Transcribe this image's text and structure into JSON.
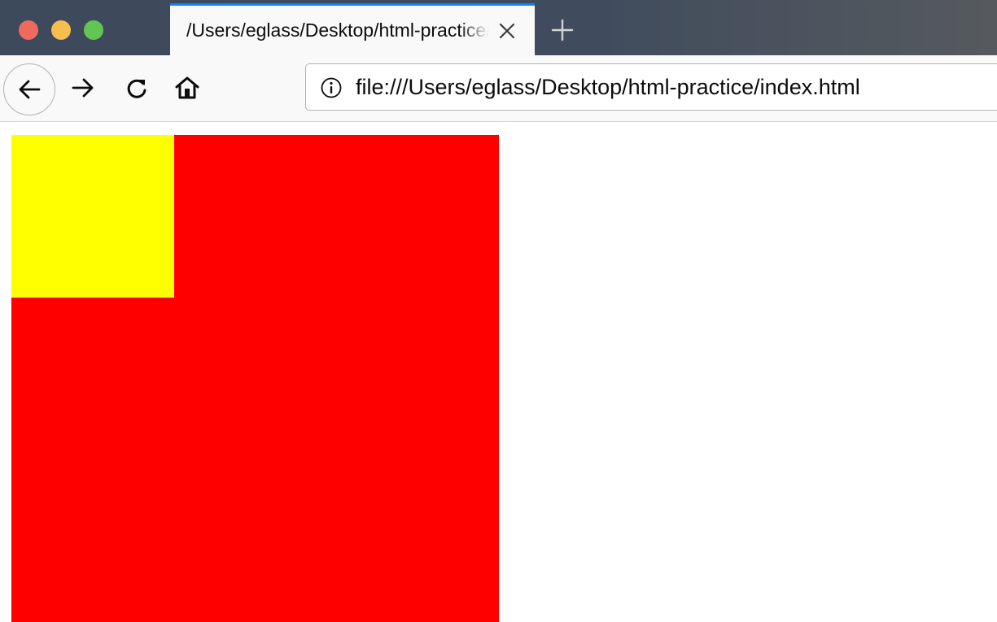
{
  "window": {
    "controls": {
      "close_color": "#ee6a5f",
      "minimize_color": "#f5be4f",
      "maximize_color": "#62c554"
    }
  },
  "tabs": [
    {
      "title": "/Users/eglass/Desktop/html-practice/index.html",
      "active": true,
      "close_icon": "close-icon"
    }
  ],
  "new_tab_icon": "plus-icon",
  "toolbar": {
    "back_icon": "back-arrow-icon",
    "forward_icon": "forward-arrow-icon",
    "reload_icon": "reload-icon",
    "home_icon": "home-icon",
    "accent_color": "#0a84ff"
  },
  "urlbar": {
    "site_info_icon": "info-icon",
    "url": "file:///Users/eglass/Desktop/html-practice/index.html"
  },
  "page": {
    "outer_box_color": "#ff0000",
    "inner_box_color": "#ffff00"
  }
}
